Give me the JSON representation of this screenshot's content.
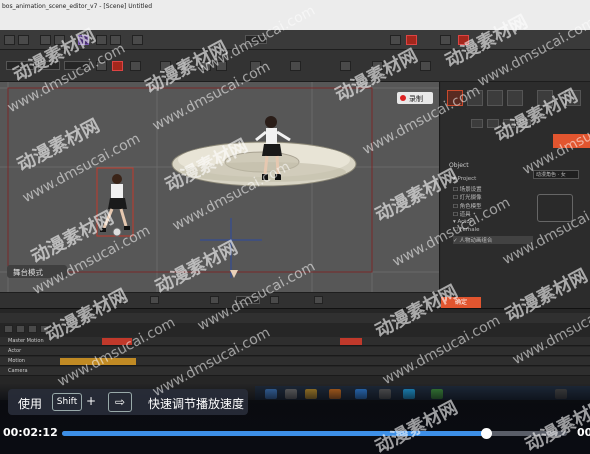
{
  "window": {
    "title": "bos_animation_scene_editor_v7 - [Scene] Untitled",
    "record_label": "录制"
  },
  "viewport": {
    "bottom_label": "舞台模式",
    "bg_color": "#575757",
    "disc_color": "#dad6c8"
  },
  "right_panel": {
    "section_label": "Object",
    "field_value": "动漫角色 · 女",
    "tree": [
      {
        "label": "▾ Project"
      },
      {
        "label": "  ☐ 场景设置"
      },
      {
        "label": "  ☐ 灯光摄像"
      },
      {
        "label": "  ☐ 角色模型"
      },
      {
        "label": "  ☐ 道具"
      },
      {
        "label": "▾ Actor"
      },
      {
        "label": "  ☐ Female"
      },
      {
        "label": "  ✓ 人物动画组合"
      }
    ],
    "bottom_button": "确定",
    "accent": "#e2552f"
  },
  "timeline": {
    "tracks": [
      {
        "label": "Master Motion"
      },
      {
        "label": "Actor"
      },
      {
        "label": "Motion"
      },
      {
        "label": "Camera"
      }
    ]
  },
  "player": {
    "tip_use": "使用",
    "tip_key": "Shift",
    "tip_plus": "+",
    "tip_arrow": "⇨",
    "tip_text": "快速调节播放速度",
    "current_time": "00:02:12",
    "end_time": "00",
    "progress": 0.84,
    "accent": "#3d8fe6"
  },
  "watermarks": {
    "cn": "动漫素材网",
    "url": "www.dmsucai.com"
  }
}
